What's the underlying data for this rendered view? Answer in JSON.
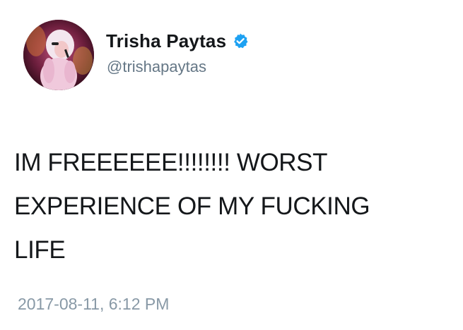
{
  "tweet": {
    "display_name": "Trisha Paytas",
    "handle": "@trishapaytas",
    "verified": true,
    "text_lines": [
      "IM FREEEEEE!!!!!!!! WORST",
      "EXPERIENCE OF MY FUCKING",
      "LIFE"
    ],
    "timestamp": "2017-08-11, 6:12 PM"
  },
  "icons": {
    "avatar": "profile-photo",
    "verified": "verified-badge-icon"
  },
  "colors": {
    "verified_blue": "#1da1f2",
    "handle_gray": "#657786",
    "timestamp_gray": "#8899a6",
    "text": "#14171a"
  }
}
